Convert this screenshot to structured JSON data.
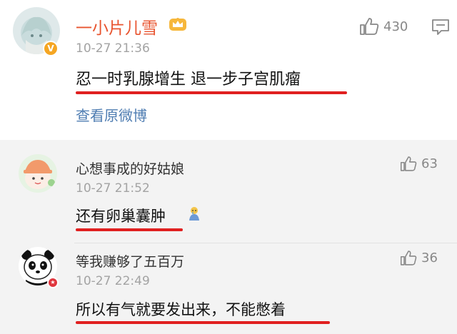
{
  "main_comment": {
    "username": "一小片儿雪",
    "verified_badge": "V",
    "vip_icon": "crown-icon",
    "timestamp": "10-27 21:36",
    "text": "忍一时乳腺增生 退一步子宫肌瘤",
    "view_original_label": "查看原微博",
    "like_count": "430",
    "like_icon": "thumbs-up-icon",
    "comment_icon": "comment-icon"
  },
  "replies": [
    {
      "username": "心想事成的好姑娘",
      "timestamp": "10-27 21:52",
      "text": "还有卵巢囊肿",
      "emoji": "crying-figure-emoji",
      "like_count": "63"
    },
    {
      "username": "等我赚够了五百万",
      "timestamp": "10-27 22:49",
      "text": "所以有气就要发出来，不能憋着",
      "like_count": "36"
    }
  ],
  "colors": {
    "username_main": "#e8542f",
    "link": "#4f7db2",
    "underline": "#e02020",
    "reply_background": "#f3f3f3",
    "timestamp": "#a3a3a3"
  }
}
